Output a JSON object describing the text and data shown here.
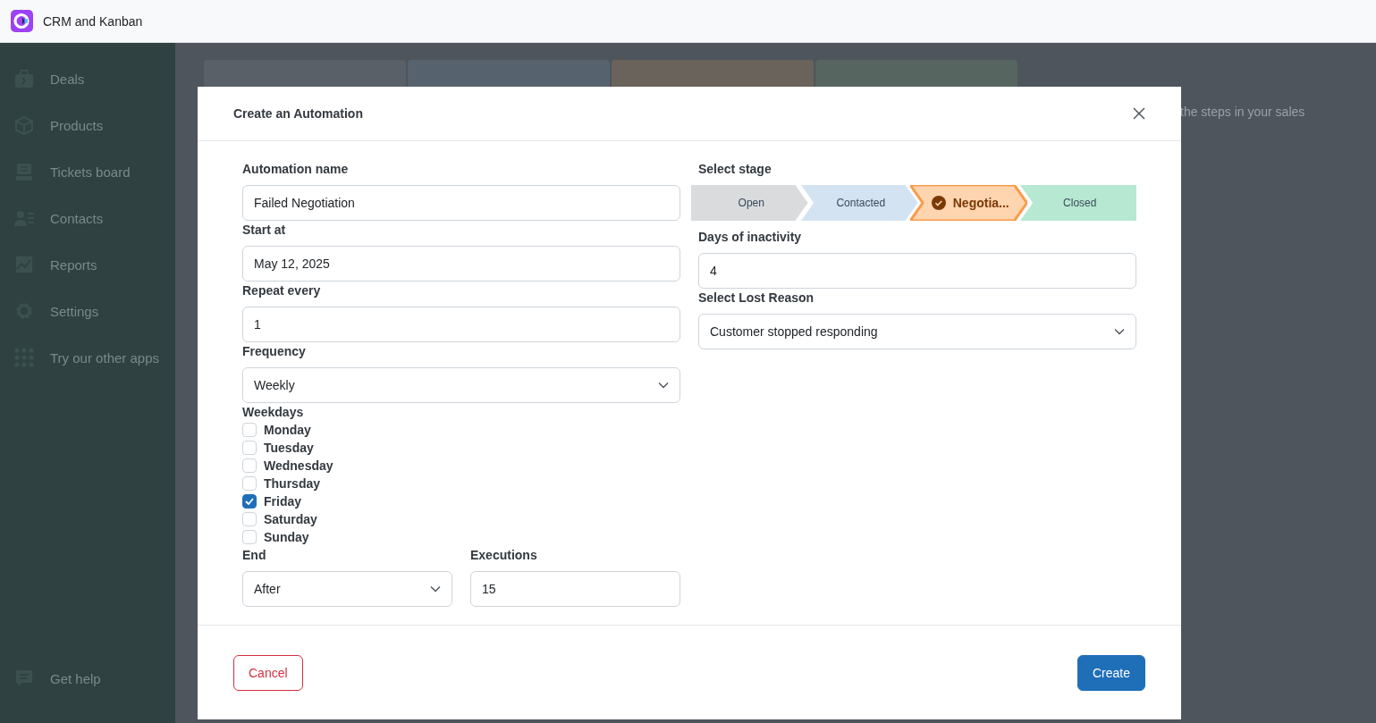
{
  "app": {
    "title": "CRM and Kanban"
  },
  "sidebar": {
    "items": [
      {
        "label": "Deals"
      },
      {
        "label": "Products"
      },
      {
        "label": "Tickets board"
      },
      {
        "label": "Contacts"
      },
      {
        "label": "Reports"
      },
      {
        "label": "Settings"
      },
      {
        "label": "Try our other apps"
      }
    ],
    "footer_item": {
      "label": "Get help"
    }
  },
  "board": {
    "columns": [
      {
        "color": "#596067"
      },
      {
        "color": "#56636e"
      },
      {
        "color": "#6a635b"
      },
      {
        "color": "#56655f"
      }
    ],
    "add_stage": {
      "hint": "the steps in your sales"
    }
  },
  "modal": {
    "title": "Create an Automation",
    "automation_name": {
      "label": "Automation name",
      "value": "Failed Negotiation"
    },
    "start_at": {
      "label": "Start at",
      "value": "May 12, 2025"
    },
    "repeat_every": {
      "label": "Repeat every",
      "value": "1"
    },
    "frequency": {
      "label": "Frequency",
      "value": "Weekly"
    },
    "weekdays": {
      "label": "Weekdays",
      "days": [
        {
          "label": "Monday",
          "checked": false
        },
        {
          "label": "Tuesday",
          "checked": false
        },
        {
          "label": "Wednesday",
          "checked": false
        },
        {
          "label": "Thursday",
          "checked": false
        },
        {
          "label": "Friday",
          "checked": true
        },
        {
          "label": "Saturday",
          "checked": false
        },
        {
          "label": "Sunday",
          "checked": false
        }
      ]
    },
    "end": {
      "label": "End",
      "value": "After"
    },
    "executions": {
      "label": "Executions",
      "value": "15"
    },
    "stage": {
      "label": "Select stage",
      "stages": [
        {
          "label": "Open",
          "color": "#d9dbdd",
          "selected": false
        },
        {
          "label": "Contacted",
          "color": "#d3e3f2",
          "selected": false
        },
        {
          "label": "Negotia...",
          "color": "#ffd5b0",
          "selected": true
        },
        {
          "label": "Closed",
          "color": "#b7e8d2",
          "selected": false
        }
      ]
    },
    "days_of_inactivity": {
      "label": "Days of inactivity",
      "value": "4"
    },
    "lost_reason": {
      "label": "Select Lost Reason",
      "value": "Customer stopped responding"
    },
    "buttons": {
      "cancel": "Cancel",
      "create": "Create"
    }
  }
}
